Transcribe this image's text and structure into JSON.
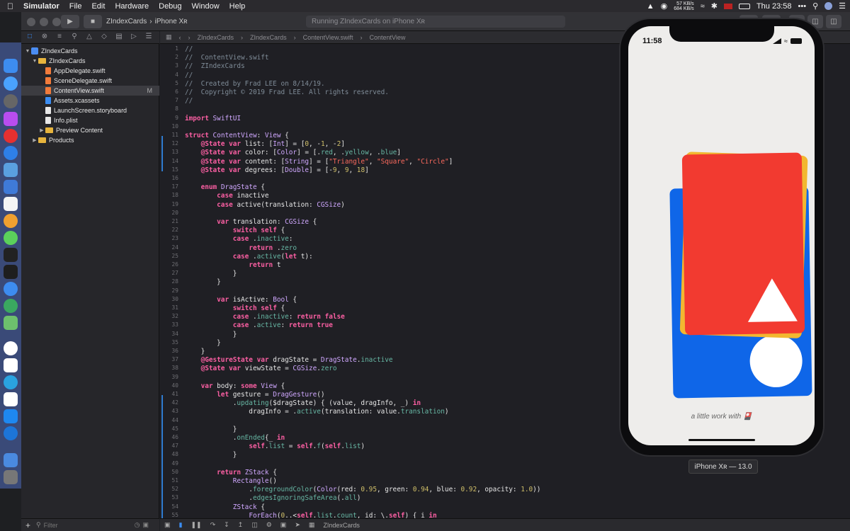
{
  "menubar": {
    "app": "Simulator",
    "items": [
      "File",
      "Edit",
      "Hardware",
      "Debug",
      "Window",
      "Help"
    ],
    "net_up": "57 KB/s",
    "net_down": "684 KB/s",
    "clock": "Thu 23:58",
    "more": "•••"
  },
  "toolbar": {
    "scheme": "ZIndexCards",
    "device": "iPhone Xʀ",
    "status": "Running ZIndexCards on iPhone Xʀ"
  },
  "navigator": {
    "items": [
      {
        "label": "ZIndexCards",
        "kind": "project",
        "indent": 0
      },
      {
        "label": "ZIndexCards",
        "kind": "folder",
        "indent": 1
      },
      {
        "label": "AppDelegate.swift",
        "kind": "swift",
        "indent": 2
      },
      {
        "label": "SceneDelegate.swift",
        "kind": "swift",
        "indent": 2
      },
      {
        "label": "ContentView.swift",
        "kind": "swift",
        "indent": 2,
        "badge": "M",
        "selected": true
      },
      {
        "label": "Assets.xcassets",
        "kind": "assets",
        "indent": 2
      },
      {
        "label": "LaunchScreen.storyboard",
        "kind": "file",
        "indent": 2
      },
      {
        "label": "Info.plist",
        "kind": "file",
        "indent": 2
      },
      {
        "label": "Preview Content",
        "kind": "folder",
        "indent": 2
      },
      {
        "label": "Products",
        "kind": "folder",
        "indent": 1
      }
    ],
    "filter_placeholder": "Filter"
  },
  "jumpbar": [
    "ZIndexCards",
    "ZIndexCards",
    "ContentView.swift",
    "ContentView"
  ],
  "editor": {
    "lines": [
      "//",
      "//  ContentView.swift",
      "//  ZIndexCards",
      "//",
      "//  Created by Frad LEE on 8/14/19.",
      "//  Copyright © 2019 Frad LEE. All rights reserved.",
      "//",
      "",
      "import SwiftUI",
      "",
      "struct ContentView: View {",
      "    @State var list: [Int] = [0, -1, -2]",
      "    @State var color: [Color] = [.red, .yellow, .blue]",
      "    @State var content: [String] = [\"Triangle\", \"Square\", \"Circle\"]",
      "    @State var degrees: [Double] = [-9, 9, 18]",
      "",
      "    enum DragState {",
      "        case inactive",
      "        case active(translation: CGSize)",
      "",
      "        var translation: CGSize {",
      "            switch self {",
      "            case .inactive:",
      "                return .zero",
      "            case .active(let t):",
      "                return t",
      "            }",
      "        }",
      "",
      "        var isActive: Bool {",
      "            switch self {",
      "            case .inactive: return false",
      "            case .active: return true",
      "            }",
      "        }",
      "    }",
      "    @GestureState var dragState = DragState.inactive",
      "    @State var viewState = CGSize.zero",
      "",
      "    var body: some View {",
      "        let gesture = DragGesture()",
      "            .updating($dragState) { (value, dragInfo, _) in",
      "                dragInfo = .active(translation: value.translation)",
      "",
      "            }",
      "            .onEnded{_ in",
      "                self.list = self.f(self.list)",
      "            }",
      "",
      "        return ZStack {",
      "            Rectangle()",
      "                .foregroundColor(Color(red: 0.95, green: 0.94, blue: 0.92, opacity: 1.0))",
      "                .edgesIgnoringSafeArea(.all)",
      "            ZStack {",
      "                ForEach(0..<self.list.count, id: \\.self) { i in"
    ]
  },
  "simulator": {
    "time": "11:58",
    "caption": "a little work with 🎴",
    "device_label": "iPhone Xʀ — 13.0",
    "card_colors": {
      "red": "#f23a30",
      "yellow": "#f2b730",
      "blue": "#0f66e8"
    }
  },
  "debugbar": {
    "target": "ZIndexCards"
  }
}
